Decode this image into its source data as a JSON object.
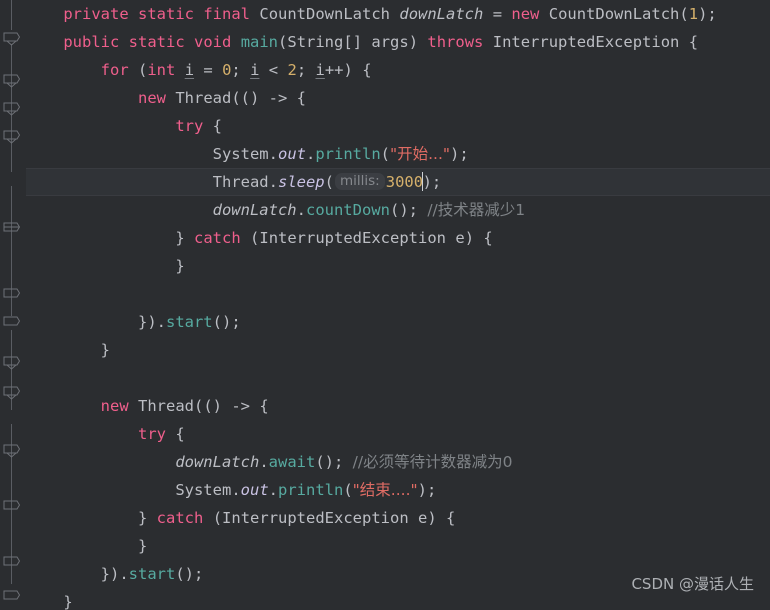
{
  "editor": {
    "theme": "darcula",
    "background": "#2b2d30",
    "current_line_background": "#303337",
    "default_text_color": "#bcbec4",
    "colors": {
      "keyword": "#ef5f8c",
      "string": "#e06c64",
      "number": "#d5b06b",
      "comment": "#7f8387",
      "method": "#57aaa0",
      "static_field": "#c9c2e3",
      "gutter_line": "#5a5d63",
      "param_hint_bg": "#3b3e43",
      "param_hint_fg": "#85888d",
      "caret": "#cfd2d6"
    },
    "caret_line_index": 5,
    "caret_after_text": "300"
  },
  "gutter": {
    "fold_marker_count": 14,
    "guide_label": "code-folding-gutter"
  },
  "param_hints": [
    {
      "label": "millis:"
    }
  ],
  "lines": [
    {
      "index": 0,
      "indent": 1,
      "text": "private static final CountDownLatch downLatch = new CountDownLatch(1);"
    },
    {
      "index": 1,
      "indent": 1,
      "text": "public static void main(String[] args) throws InterruptedException {"
    },
    {
      "index": 2,
      "indent": 2,
      "text": "for (int i = 0; i < 2; i++) {"
    },
    {
      "index": 3,
      "indent": 3,
      "text": "new Thread(() -> {"
    },
    {
      "index": 4,
      "indent": 4,
      "text": "try {"
    },
    {
      "index": 5,
      "indent": 5,
      "text": "System.out.println(\"开始...\");"
    },
    {
      "index": 6,
      "indent": 5,
      "text": "Thread.sleep( millis: 3000);"
    },
    {
      "index": 7,
      "indent": 5,
      "text": "downLatch.countDown(); //技术器减少1"
    },
    {
      "index": 8,
      "indent": 4,
      "text": "} catch (InterruptedException e) {"
    },
    {
      "index": 9,
      "indent": 4,
      "text": "}"
    },
    {
      "index": 10,
      "indent": 0,
      "text": ""
    },
    {
      "index": 11,
      "indent": 3,
      "text": "}).start();"
    },
    {
      "index": 12,
      "indent": 2,
      "text": "}"
    },
    {
      "index": 13,
      "indent": 0,
      "text": ""
    },
    {
      "index": 14,
      "indent": 2,
      "text": "new Thread(() -> {"
    },
    {
      "index": 15,
      "indent": 3,
      "text": "try {"
    },
    {
      "index": 16,
      "indent": 4,
      "text": "downLatch.await(); //必须等待计数器减为0"
    },
    {
      "index": 17,
      "indent": 4,
      "text": "System.out.println(\"结束....\");"
    },
    {
      "index": 18,
      "indent": 3,
      "text": "} catch (InterruptedException e) {"
    },
    {
      "index": 19,
      "indent": 3,
      "text": "}"
    },
    {
      "index": 20,
      "indent": 2,
      "text": "}).start();"
    },
    {
      "index": 21,
      "indent": 1,
      "text": "}"
    }
  ],
  "tokens": {
    "private": "private",
    "static": "static",
    "final": "final",
    "public": "public",
    "void": "void",
    "new": "new",
    "try": "try",
    "catch": "catch",
    "for": "for",
    "int": "int",
    "throws": "throws",
    "CountDownLatch": "CountDownLatch",
    "downLatch": "downLatch",
    "main": "main",
    "String": "String",
    "args": "args",
    "InterruptedException": "InterruptedException",
    "Thread": "Thread",
    "System": "System",
    "out": "out",
    "println": "println",
    "sleep": "sleep",
    "countDown": "countDown",
    "await": "await",
    "start": "start",
    "e": "e",
    "i": "i",
    "num_1": "1",
    "num_0": "0",
    "num_2": "2",
    "num_3000": "3000",
    "str_start": "\"开始...\"",
    "str_end": "\"结束....\"",
    "cmt_countdown": "//技术器减少1",
    "cmt_await": "//必须等待计数器减为0",
    "hint_millis": "millis:"
  },
  "watermark": {
    "text": "CSDN @漫话人生"
  }
}
